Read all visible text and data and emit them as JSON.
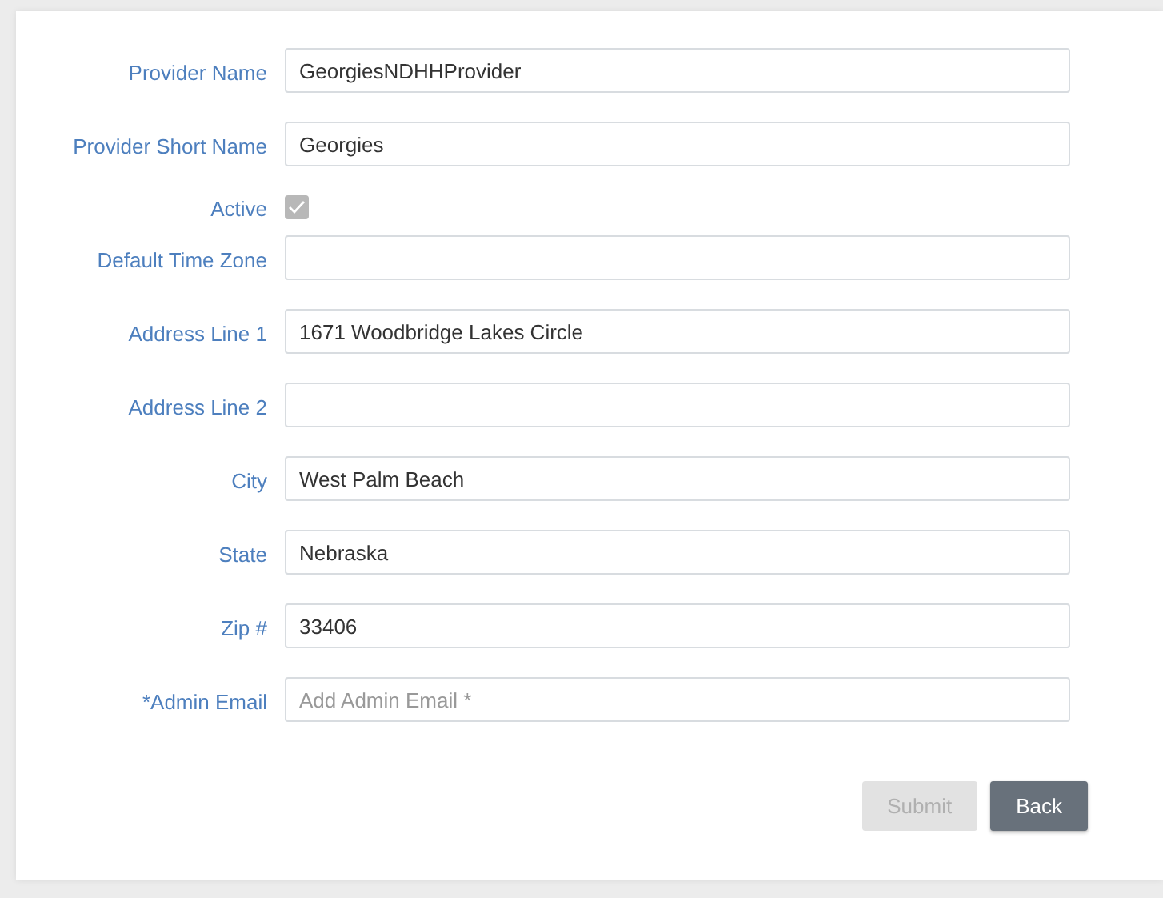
{
  "fields": [
    {
      "kind": "text",
      "label": "Provider Name",
      "value": "GeorgiesNDHHProvider"
    },
    {
      "kind": "text",
      "label": "Provider Short Name",
      "value": "Georgies"
    },
    {
      "kind": "checkbox",
      "label": "Active",
      "checked": true,
      "disabled": true
    },
    {
      "kind": "text",
      "label": "Default Time Zone"
    },
    {
      "kind": "text",
      "label": "Address Line 1",
      "value": "1671 Woodbridge Lakes Circle"
    },
    {
      "kind": "text",
      "label": "Address Line 2"
    },
    {
      "kind": "text",
      "label": "City",
      "value": "West Palm Beach"
    },
    {
      "kind": "text",
      "label": "State",
      "value": "Nebraska"
    },
    {
      "kind": "text",
      "label": "Zip #",
      "value": "33406"
    },
    {
      "kind": "text",
      "label": "*Admin Email",
      "placeholder": "Add Admin Email *"
    }
  ],
  "buttons": [
    {
      "label": "Submit",
      "kind": "primary",
      "disabled": true
    },
    {
      "label": "Back",
      "kind": "secondary",
      "disabled": false
    }
  ]
}
